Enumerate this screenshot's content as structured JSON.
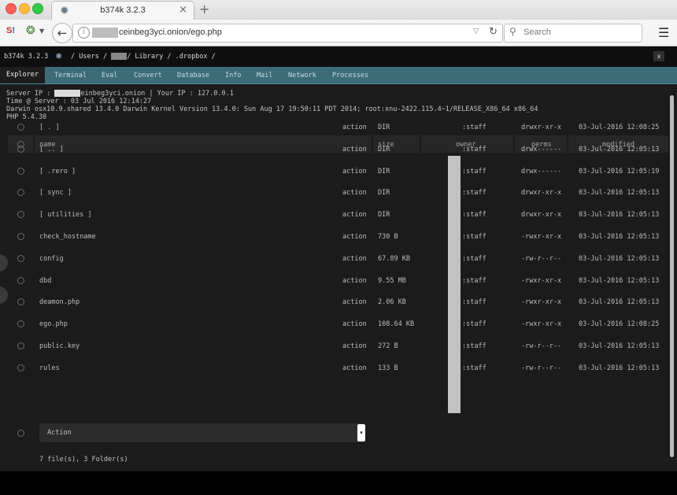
{
  "browser": {
    "tab_title": "b374k 3.2.3",
    "tab_close": "×",
    "new_tab": "+",
    "ext1": "S",
    "ext1_suffix": "!",
    "url_text": "ceinbeg3yci.onion/ego.php",
    "search_placeholder": "Search"
  },
  "header": {
    "shell_name": "b374k 3.2.3",
    "path_prefix": "/ Users /",
    "path_suffix": "/ Library / .dropbox /",
    "close_label": "x"
  },
  "menu": {
    "items": [
      "Explorer",
      "Terminal",
      "Eval",
      "Convert",
      "Database",
      "Info",
      "Mail",
      "Network",
      "Processes"
    ],
    "active": "Explorer"
  },
  "server_info": {
    "server_ip_prefix": "Server IP : ",
    "server_ip_suffix": "einbeg3yci.onion | Your IP : 127.0.0.1",
    "time_line": "Time @ Server : 03 Jul 2016 12:14:27",
    "kernel_line": "Darwin osx10.9.shared 13.4.0 Darwin Kernel Version 13.4.0: Sun Aug 17 19:50:11 PDT 2014; root:xnu-2422.115.4~1/RELEASE_X86_64 x86_64",
    "php_line": "PHP 5.4.30"
  },
  "table": {
    "headers": {
      "name": "name",
      "size": "size",
      "owner": "owner",
      "perms": "perms",
      "modified": "modified"
    },
    "rows": [
      {
        "name": "[ . ]",
        "action": "action",
        "size": "DIR",
        "owner": ":staff",
        "perms": "drwxr-xr-x",
        "modified": "03-Jul-2016 12:08:25"
      },
      {
        "name": "[ .. ]",
        "action": "action",
        "size": "DIR",
        "owner": ":staff",
        "perms": "drwx------",
        "modified": "03-Jul-2016 12:05:13"
      },
      {
        "name": "[ .rero ]",
        "action": "action",
        "size": "DIR",
        "owner": ":staff",
        "perms": "drwx------",
        "modified": "03-Jul-2016 12:05:19"
      },
      {
        "name": "[ sync ]",
        "action": "action",
        "size": "DIR",
        "owner": ":staff",
        "perms": "drwxr-xr-x",
        "modified": "03-Jul-2016 12:05:13"
      },
      {
        "name": "[ utilities ]",
        "action": "action",
        "size": "DIR",
        "owner": ":staff",
        "perms": "drwxr-xr-x",
        "modified": "03-Jul-2016 12:05:13"
      },
      {
        "name": "check_hostname",
        "action": "action",
        "size": "730 B",
        "owner": ":staff",
        "perms": "-rwxr-xr-x",
        "modified": "03-Jul-2016 12:05:13"
      },
      {
        "name": "config",
        "action": "action",
        "size": "67.89 KB",
        "owner": ":staff",
        "perms": "-rw-r--r--",
        "modified": "03-Jul-2016 12:05:13"
      },
      {
        "name": "dbd",
        "action": "action",
        "size": "9.55 MB",
        "owner": ":staff",
        "perms": "-rwxr-xr-x",
        "modified": "03-Jul-2016 12:05:13"
      },
      {
        "name": "deamon.php",
        "action": "action",
        "size": "2.06 KB",
        "owner": ":staff",
        "perms": "-rwxr-xr-x",
        "modified": "03-Jul-2016 12:05:13"
      },
      {
        "name": "ego.php",
        "action": "action",
        "size": "108.64 KB",
        "owner": ":staff",
        "perms": "-rwxr-xr-x",
        "modified": "03-Jul-2016 12:08:25"
      },
      {
        "name": "public.key",
        "action": "action",
        "size": "272 B",
        "owner": ":staff",
        "perms": "-rw-r--r--",
        "modified": "03-Jul-2016 12:05:13"
      },
      {
        "name": "rules",
        "action": "action",
        "size": "133 B",
        "owner": ":staff",
        "perms": "-rw-r--r--",
        "modified": "03-Jul-2016 12:05:13"
      }
    ]
  },
  "action_select": {
    "value": "Action"
  },
  "footer": {
    "count": "7 file(s), 3 Folder(s)"
  }
}
